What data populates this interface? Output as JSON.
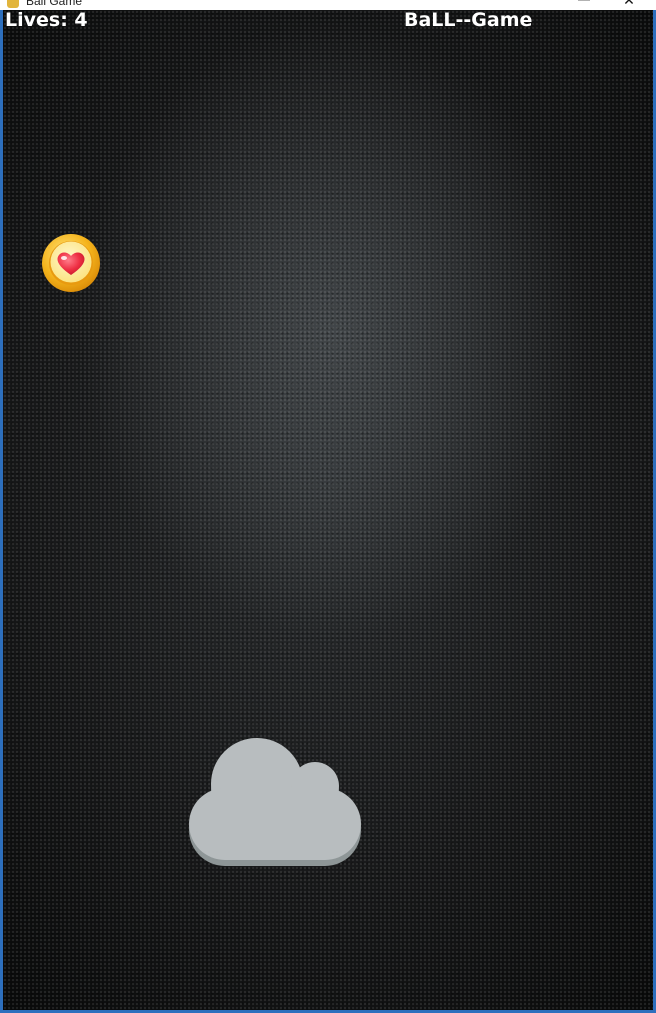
{
  "window": {
    "title": "Ball Game",
    "minimize_glyph": "—",
    "close_glyph": "✕"
  },
  "hud": {
    "lives_text": "Lives: 4",
    "game_title": "BaLL--Game"
  },
  "sprites": {
    "heart_coin": "heart-coin-icon",
    "cloud": "cloud-paddle"
  },
  "colors": {
    "window_border": "#2d6fbd",
    "hud_text": "#ffffff",
    "coin_gold": "#f2a712",
    "heart_red": "#e8283a",
    "cloud_gray": "#b8bdbf",
    "cloud_shadow": "#8e9697"
  }
}
